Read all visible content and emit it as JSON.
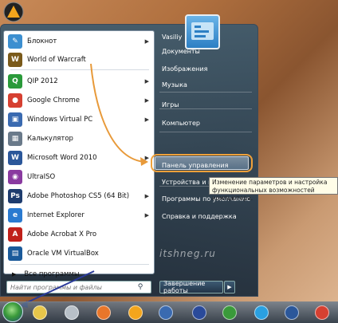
{
  "colors": {
    "highlight_ring": "#f0a13a",
    "arrow_orange": "#e89a3a",
    "arrow_blue": "#2a3a9a",
    "menu_dark": "#223447"
  },
  "pinned": [
    {
      "label": "Блокнот",
      "icon": "notepad-icon",
      "color": "#3c8fd0",
      "glyph": "✎",
      "submenu": true
    },
    {
      "label": "World of Warcraft",
      "icon": "wow-icon",
      "color": "#7a5a1a",
      "glyph": "W",
      "submenu": false
    }
  ],
  "recent": [
    {
      "label": "QIP 2012",
      "icon": "qip-icon",
      "color": "#2a9a3a",
      "glyph": "Q",
      "submenu": true
    },
    {
      "label": "Google Chrome",
      "icon": "chrome-icon",
      "color": "#d64031",
      "glyph": "●",
      "submenu": true
    },
    {
      "label": "Windows Virtual PC",
      "icon": "virtual-pc-icon",
      "color": "#3a6ab0",
      "glyph": "▣",
      "submenu": true
    },
    {
      "label": "Калькулятор",
      "icon": "calculator-icon",
      "color": "#6a7a8a",
      "glyph": "▦",
      "submenu": false
    },
    {
      "label": "Microsoft Word 2010",
      "icon": "word-icon",
      "color": "#2b579a",
      "glyph": "W",
      "submenu": true
    },
    {
      "label": "UltraISO",
      "icon": "ultraiso-icon",
      "color": "#8a3aa0",
      "glyph": "◉",
      "submenu": false
    },
    {
      "label": "Adobe Photoshop CS5 (64 Bit)",
      "icon": "photoshop-icon",
      "color": "#1e3c6e",
      "glyph": "Ps",
      "submenu": true
    },
    {
      "label": "Internet Explorer",
      "icon": "ie-icon",
      "color": "#2a7ad0",
      "glyph": "e",
      "submenu": true
    },
    {
      "label": "Adobe Acrobat X Pro",
      "icon": "acrobat-icon",
      "color": "#c0201a",
      "glyph": "A",
      "submenu": false
    },
    {
      "label": "Oracle VM VirtualBox",
      "icon": "virtualbox-icon",
      "color": "#1a5a9a",
      "glyph": "▤",
      "submenu": false
    }
  ],
  "all_programs": "Все программы",
  "search_placeholder": "Найти программы и файлы",
  "right_items": [
    {
      "label": "Vasiliy",
      "submenu": false
    },
    {
      "label": "Документы",
      "submenu": false
    },
    {
      "label": "Изображения",
      "submenu": false
    },
    {
      "label": "Музыка",
      "submenu": false
    },
    {
      "label": "Игры",
      "submenu": false
    },
    {
      "label": "Компьютер",
      "submenu": false
    },
    {
      "label": "Панель управления",
      "submenu": false
    },
    {
      "label": "Устройства и принтеры",
      "submenu": false
    },
    {
      "label": "Программы по умолчанию",
      "submenu": false
    },
    {
      "label": "Справка и поддержка",
      "submenu": false
    }
  ],
  "tooltip": "Изменение параметров и настройка функциональных возможностей компьютера.",
  "shutdown": "Завершение работы",
  "watermark": "itshneg.ru",
  "taskbar": [
    "start-orb-icon",
    "explorer-icon",
    "robot-icon",
    "firefox-icon",
    "aimp-icon",
    "wow-taskbar-icon",
    "save-icon",
    "utorrent-icon",
    "skype-icon",
    "word-taskbar-icon",
    "chrome-taskbar-icon"
  ]
}
